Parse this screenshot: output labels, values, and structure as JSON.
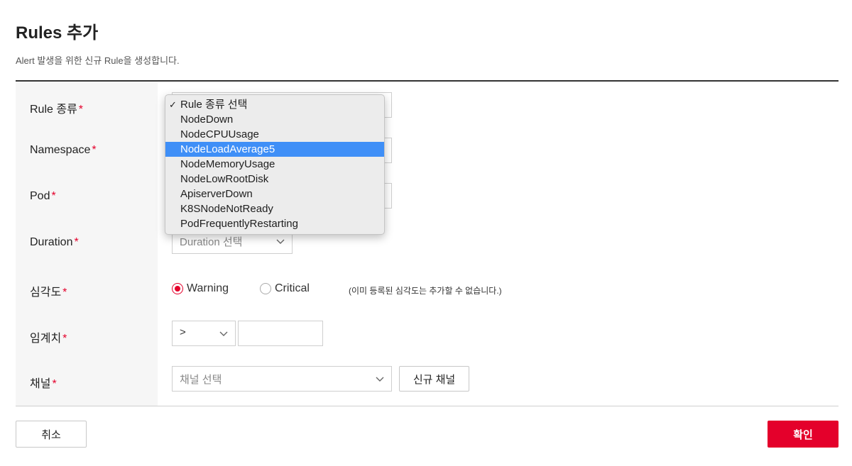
{
  "page": {
    "title": "Rules 추가",
    "description": "Alert 발생을 위한 신규 Rule을 생성합니다."
  },
  "form": {
    "required_mark": "*",
    "rule_type": {
      "label": "Rule 종류"
    },
    "namespace": {
      "label": "Namespace"
    },
    "pod": {
      "label": "Pod"
    },
    "duration": {
      "label": "Duration",
      "value": "Duration 선택"
    },
    "severity": {
      "label": "심각도",
      "options": [
        "Warning",
        "Critical"
      ],
      "selected": "Warning",
      "note": "(이미 등록된 심각도는 추가할 수 없습니다.)"
    },
    "threshold": {
      "label": "임계치",
      "operator": ">",
      "value": ""
    },
    "channel": {
      "label": "채널",
      "value": "채널 선택",
      "new_button": "신규 채널"
    }
  },
  "dropdown": {
    "selected": "Rule 종류 선택",
    "highlighted": "NodeLoadAverage5",
    "options": [
      "Rule 종류 선택",
      "NodeDown",
      "NodeCPUUsage",
      "NodeLoadAverage5",
      "NodeMemoryUsage",
      "NodeLowRootDisk",
      "ApiserverDown",
      "K8SNodeNotReady",
      "PodFrequentlyRestarting"
    ]
  },
  "footer": {
    "cancel_label": "취소",
    "confirm_label": "확인"
  },
  "colors": {
    "accent": "#e4002b",
    "highlight": "#3f8ff7"
  },
  "icons": {
    "check": "checkmark-icon",
    "chevron": "chevron-down-icon"
  }
}
